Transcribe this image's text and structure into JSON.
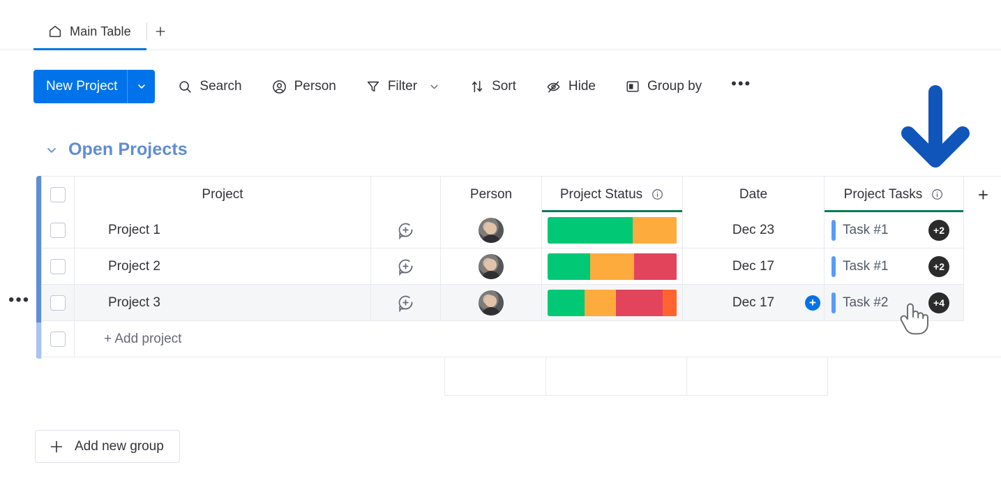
{
  "tabs": {
    "home_icon": "home-icon",
    "active_tab": "Main Table",
    "add_tab_label": "+"
  },
  "toolbar": {
    "new_project_label": "New Project",
    "new_project_color": "#0073ea",
    "items": [
      {
        "label": "Search",
        "icon": "search-icon"
      },
      {
        "label": "Person",
        "icon": "person-icon"
      },
      {
        "label": "Filter",
        "icon": "filter-icon",
        "caret": true
      },
      {
        "label": "Sort",
        "icon": "sort-icon"
      },
      {
        "label": "Hide",
        "icon": "eye-off-icon"
      },
      {
        "label": "Group by",
        "icon": "group-by-icon"
      }
    ],
    "more_label": "•••"
  },
  "group": {
    "title": "Open Projects",
    "color": "#5f8cd8",
    "collapse_icon": "chevron-down-icon"
  },
  "table": {
    "columns": [
      {
        "key": "project",
        "label": "Project"
      },
      {
        "key": "person",
        "label": "Person"
      },
      {
        "key": "status",
        "label": "Project Status",
        "info": true,
        "underline": "#0b7b55"
      },
      {
        "key": "date",
        "label": "Date"
      },
      {
        "key": "tasks",
        "label": "Project Tasks",
        "info": true,
        "underline": "#0b7b55"
      }
    ],
    "add_column_label": "+",
    "rows": [
      {
        "project": "Project 1",
        "date": "Dec 23",
        "task_label": "Task #1",
        "task_badge": "+2",
        "status_segments": [
          {
            "color": "#00c875",
            "pct": 66
          },
          {
            "color": "#fdab3d",
            "pct": 34
          }
        ]
      },
      {
        "project": "Project 2",
        "date": "Dec 17",
        "task_label": "Task #1",
        "task_badge": "+2",
        "status_segments": [
          {
            "color": "#00c875",
            "pct": 33
          },
          {
            "color": "#fdab3d",
            "pct": 34
          },
          {
            "color": "#e2445c",
            "pct": 33
          }
        ]
      },
      {
        "project": "Project 3",
        "date": "Dec 17",
        "task_label": "Task #2",
        "task_badge": "+4",
        "hover": true,
        "show_task_add": true,
        "status_segments": [
          {
            "color": "#00c875",
            "pct": 29
          },
          {
            "color": "#fdab3d",
            "pct": 24
          },
          {
            "color": "#e2445c",
            "pct": 36
          },
          {
            "color": "#ff642e",
            "pct": 11
          }
        ]
      }
    ],
    "add_row_label": "+ Add project",
    "row_menu_label": "•••"
  },
  "footer": {
    "add_group_label": "Add new group",
    "add_group_icon": "plus-icon"
  },
  "annotation": {
    "arrow_color": "#1055ba",
    "arrow_icon": "down-arrow-annotation",
    "cursor_icon": "pointing-hand-cursor"
  }
}
